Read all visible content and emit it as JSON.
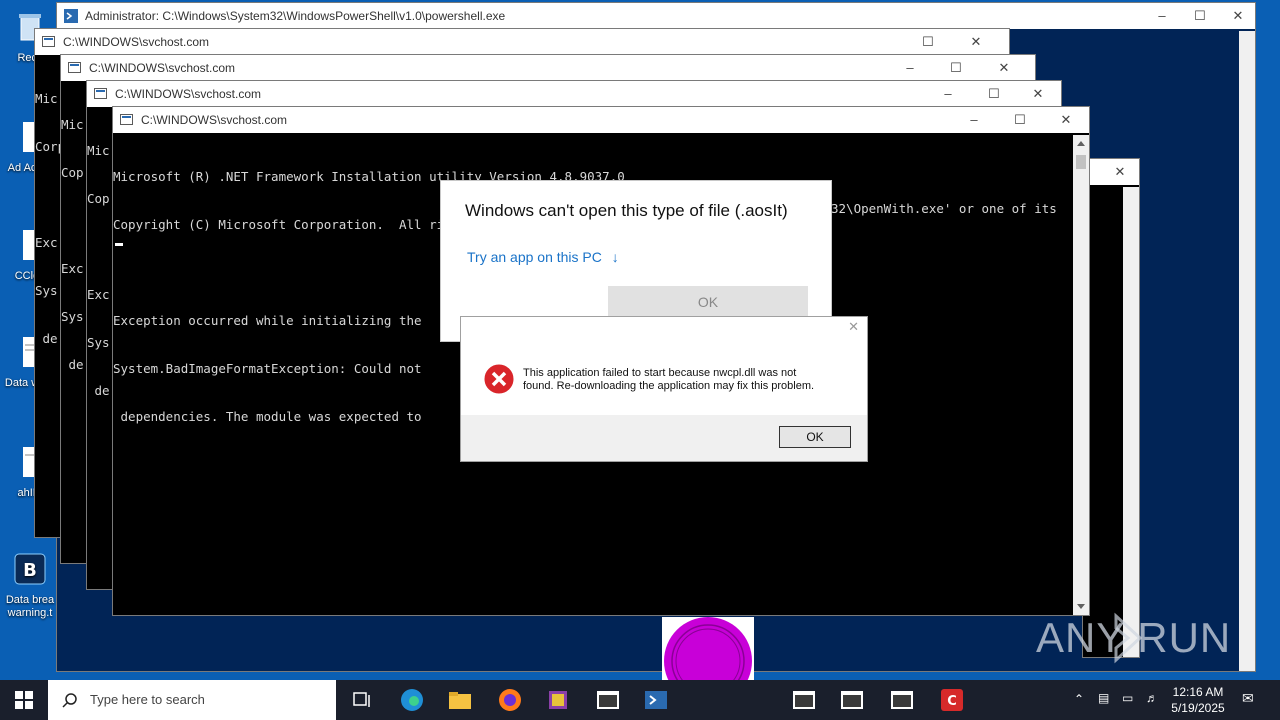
{
  "desktop_icons": [
    {
      "label": "Recy",
      "icon": "recycle-bin-icon"
    },
    {
      "label": "Ad Acrob",
      "icon": "acrobat-icon"
    },
    {
      "label": "CClea",
      "icon": "ccleaner-icon"
    },
    {
      "label": "Data warn",
      "icon": "document-icon"
    },
    {
      "label": "ahIFI",
      "icon": "document-icon"
    },
    {
      "label": "Data brea warning.t",
      "icon": "bitdefender-icon"
    }
  ],
  "windows": {
    "powershell": {
      "title": "Administrator: C:\\Windows\\System32\\WindowsPowerShell\\v1.0\\powershell.exe"
    },
    "svchost_titles": [
      "C:\\WINDOWS\\svchost.com",
      "C:\\WINDOWS\\svchost.com",
      "C:\\WINDOWS\\svchost.com",
      "C:\\WINDOWS\\svchost.com"
    ],
    "back_console_lines": {
      "w1": [
        "Mic",
        "Corp",
        "",
        "Exc",
        "Sys",
        " de"
      ],
      "w2": [
        "Mic",
        "Cop",
        "",
        "Exc",
        "Sys",
        " de"
      ],
      "w3": [
        "Mic",
        "Cop",
        "",
        "Exc",
        "Sys",
        " de"
      ]
    },
    "front_console_lines": [
      "Microsoft (R) .NET Framework Installation utility Version 4.8.9037.0",
      "Copyright (C) Microsoft Corporation.  All rights reserved.",
      "",
      "Exception occurred while initializing the",
      "System.BadImageFormatException: Could not",
      " dependencies. The module was expected to"
    ],
    "front_console_right": "32\\OpenWith.exe' or one of its"
  },
  "openwith_dialog": {
    "title": "Windows can't open this type of file (.aosIt)",
    "link": "Try an app on this PC",
    "ok": "OK"
  },
  "error_dialog": {
    "message_line1": "This application failed to start because nwcpl.dll was not",
    "message_line2": "found. Re-downloading the application may fix this problem.",
    "ok": "OK"
  },
  "watermark": "ANY RUN",
  "taskbar": {
    "search_placeholder": "Type here to search",
    "time": "12:16 AM",
    "date": "5/19/2025"
  },
  "colors": {
    "desktop": "#0a5fb4",
    "taskbar": "#1a1f2c",
    "link": "#1a73c8",
    "error_red": "#d9252a",
    "ok_disabled": "#e1e1e1"
  }
}
